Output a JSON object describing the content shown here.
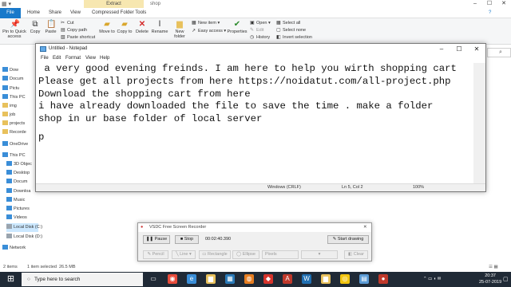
{
  "explorer": {
    "contextual_tab": "Extract",
    "window_title": "shop",
    "tabs": [
      "File",
      "Home",
      "Share",
      "View",
      "Compressed Folder Tools"
    ],
    "ribbon": {
      "pin": "Pin to Quick access",
      "copy": "Copy",
      "paste": "Paste",
      "cut": "Cut",
      "copy_path": "Copy path",
      "paste_shortcut": "Paste shortcut",
      "move_to": "Move to",
      "copy_to": "Copy to",
      "delete": "Delete",
      "rename": "Rename",
      "new_folder": "New folder",
      "new_item": "New item",
      "easy_access": "Easy access",
      "properties": "Properties",
      "open": "Open",
      "edit": "Edit",
      "history": "History",
      "select_all": "Select all",
      "select_none": "Select none",
      "invert_selection": "Invert selection"
    },
    "nav_items": [
      "Dow",
      "Docum",
      "Pictu",
      "This PC",
      "img",
      "job",
      "projects",
      "Recorde",
      "OneDrive",
      "This PC",
      "3D Objec",
      "Desktop",
      "Docum",
      "Downloa",
      "Music",
      "Pictures",
      "Videos",
      "Local Disk (C:)",
      "Local Disk (D:)",
      "Network"
    ],
    "status": {
      "items": "2 items",
      "selected": "1 item selected",
      "size": "26.5 MB"
    }
  },
  "notepad": {
    "title": "Untitled - Notepad",
    "menu": [
      "File",
      "Edit",
      "Format",
      "View",
      "Help"
    ],
    "lines": [
      " a very good evening freinds. I am here to help you wirth shopping cart",
      "Please get all projects from here https://noidatut.com/all-project.php",
      "Download the shopping cart from here",
      "i have already downloaded the file to save the time . make a folder",
      "shop in ur base folder of local server",
      "",
      "p"
    ],
    "status": {
      "encoding": "Windows (CRLF)",
      "position": "Ln 5, Col 2",
      "zoom": "100%"
    }
  },
  "recorder": {
    "title": "VSDC Free Screen Recorder",
    "pause": "Pause",
    "stop": "Stop",
    "time": "00:02:40.390",
    "start_drawing": "Start drawing",
    "tools": [
      "Pencil",
      "Line",
      "Rectangle",
      "Ellipse",
      "Pixels",
      "",
      "Clear"
    ]
  },
  "taskbar": {
    "search_placeholder": "Type here to search",
    "time": "20:37",
    "date": "25-07-2019"
  }
}
